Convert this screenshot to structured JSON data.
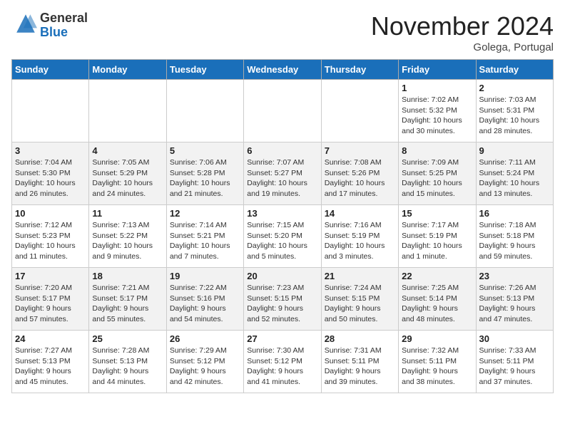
{
  "header": {
    "logo_line1": "General",
    "logo_line2": "Blue",
    "month": "November 2024",
    "location": "Golega, Portugal"
  },
  "days_of_week": [
    "Sunday",
    "Monday",
    "Tuesday",
    "Wednesday",
    "Thursday",
    "Friday",
    "Saturday"
  ],
  "weeks": [
    [
      {
        "day": "",
        "info": ""
      },
      {
        "day": "",
        "info": ""
      },
      {
        "day": "",
        "info": ""
      },
      {
        "day": "",
        "info": ""
      },
      {
        "day": "",
        "info": ""
      },
      {
        "day": "1",
        "info": "Sunrise: 7:02 AM\nSunset: 5:32 PM\nDaylight: 10 hours\nand 30 minutes."
      },
      {
        "day": "2",
        "info": "Sunrise: 7:03 AM\nSunset: 5:31 PM\nDaylight: 10 hours\nand 28 minutes."
      }
    ],
    [
      {
        "day": "3",
        "info": "Sunrise: 7:04 AM\nSunset: 5:30 PM\nDaylight: 10 hours\nand 26 minutes."
      },
      {
        "day": "4",
        "info": "Sunrise: 7:05 AM\nSunset: 5:29 PM\nDaylight: 10 hours\nand 24 minutes."
      },
      {
        "day": "5",
        "info": "Sunrise: 7:06 AM\nSunset: 5:28 PM\nDaylight: 10 hours\nand 21 minutes."
      },
      {
        "day": "6",
        "info": "Sunrise: 7:07 AM\nSunset: 5:27 PM\nDaylight: 10 hours\nand 19 minutes."
      },
      {
        "day": "7",
        "info": "Sunrise: 7:08 AM\nSunset: 5:26 PM\nDaylight: 10 hours\nand 17 minutes."
      },
      {
        "day": "8",
        "info": "Sunrise: 7:09 AM\nSunset: 5:25 PM\nDaylight: 10 hours\nand 15 minutes."
      },
      {
        "day": "9",
        "info": "Sunrise: 7:11 AM\nSunset: 5:24 PM\nDaylight: 10 hours\nand 13 minutes."
      }
    ],
    [
      {
        "day": "10",
        "info": "Sunrise: 7:12 AM\nSunset: 5:23 PM\nDaylight: 10 hours\nand 11 minutes."
      },
      {
        "day": "11",
        "info": "Sunrise: 7:13 AM\nSunset: 5:22 PM\nDaylight: 10 hours\nand 9 minutes."
      },
      {
        "day": "12",
        "info": "Sunrise: 7:14 AM\nSunset: 5:21 PM\nDaylight: 10 hours\nand 7 minutes."
      },
      {
        "day": "13",
        "info": "Sunrise: 7:15 AM\nSunset: 5:20 PM\nDaylight: 10 hours\nand 5 minutes."
      },
      {
        "day": "14",
        "info": "Sunrise: 7:16 AM\nSunset: 5:19 PM\nDaylight: 10 hours\nand 3 minutes."
      },
      {
        "day": "15",
        "info": "Sunrise: 7:17 AM\nSunset: 5:19 PM\nDaylight: 10 hours\nand 1 minute."
      },
      {
        "day": "16",
        "info": "Sunrise: 7:18 AM\nSunset: 5:18 PM\nDaylight: 9 hours\nand 59 minutes."
      }
    ],
    [
      {
        "day": "17",
        "info": "Sunrise: 7:20 AM\nSunset: 5:17 PM\nDaylight: 9 hours\nand 57 minutes."
      },
      {
        "day": "18",
        "info": "Sunrise: 7:21 AM\nSunset: 5:17 PM\nDaylight: 9 hours\nand 55 minutes."
      },
      {
        "day": "19",
        "info": "Sunrise: 7:22 AM\nSunset: 5:16 PM\nDaylight: 9 hours\nand 54 minutes."
      },
      {
        "day": "20",
        "info": "Sunrise: 7:23 AM\nSunset: 5:15 PM\nDaylight: 9 hours\nand 52 minutes."
      },
      {
        "day": "21",
        "info": "Sunrise: 7:24 AM\nSunset: 5:15 PM\nDaylight: 9 hours\nand 50 minutes."
      },
      {
        "day": "22",
        "info": "Sunrise: 7:25 AM\nSunset: 5:14 PM\nDaylight: 9 hours\nand 48 minutes."
      },
      {
        "day": "23",
        "info": "Sunrise: 7:26 AM\nSunset: 5:13 PM\nDaylight: 9 hours\nand 47 minutes."
      }
    ],
    [
      {
        "day": "24",
        "info": "Sunrise: 7:27 AM\nSunset: 5:13 PM\nDaylight: 9 hours\nand 45 minutes."
      },
      {
        "day": "25",
        "info": "Sunrise: 7:28 AM\nSunset: 5:13 PM\nDaylight: 9 hours\nand 44 minutes."
      },
      {
        "day": "26",
        "info": "Sunrise: 7:29 AM\nSunset: 5:12 PM\nDaylight: 9 hours\nand 42 minutes."
      },
      {
        "day": "27",
        "info": "Sunrise: 7:30 AM\nSunset: 5:12 PM\nDaylight: 9 hours\nand 41 minutes."
      },
      {
        "day": "28",
        "info": "Sunrise: 7:31 AM\nSunset: 5:11 PM\nDaylight: 9 hours\nand 39 minutes."
      },
      {
        "day": "29",
        "info": "Sunrise: 7:32 AM\nSunset: 5:11 PM\nDaylight: 9 hours\nand 38 minutes."
      },
      {
        "day": "30",
        "info": "Sunrise: 7:33 AM\nSunset: 5:11 PM\nDaylight: 9 hours\nand 37 minutes."
      }
    ]
  ]
}
